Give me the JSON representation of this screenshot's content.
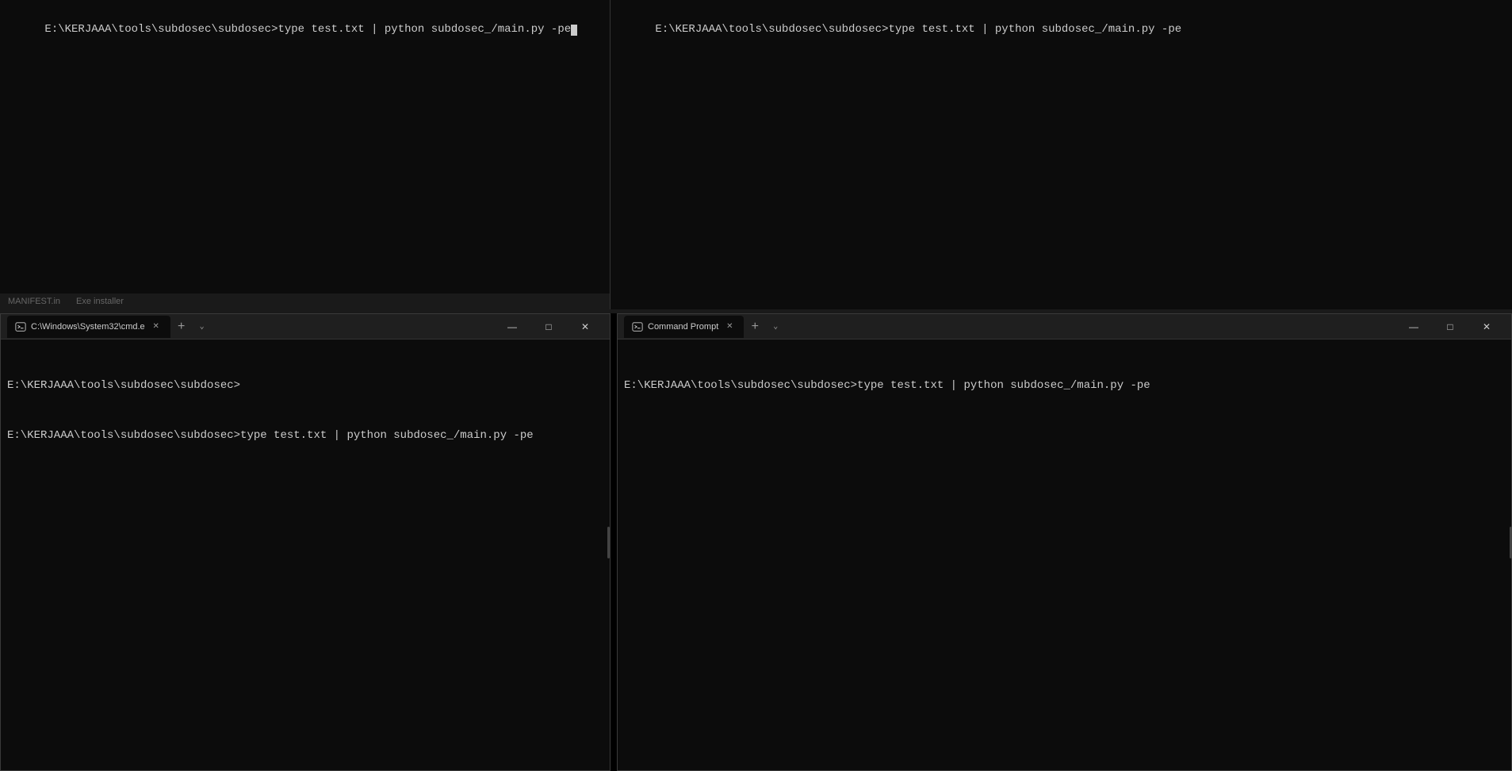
{
  "windows": {
    "top_left": {
      "command_line": "E:\\KERJAAA\\tools\\subdosec\\subdosec>type test.txt | python subdosec_/main.py -pe"
    },
    "top_right": {
      "command_line": "E:\\KERJAAA\\tools\\subdosec\\subdosec>type test.txt | python subdosec_/main.py -pe"
    },
    "bottom_left": {
      "title": "C:\\Windows\\System32\\cmd.e",
      "tab_label": "C:\\Windows\\System32\\cmd.e",
      "line1": "E:\\KERJAAA\\tools\\subdosec\\subdosec>",
      "line2": "E:\\KERJAAA\\tools\\subdosec\\subdosec>type test.txt | python subdosec_/main.py -pe",
      "controls": {
        "minimize": "—",
        "maximize": "□",
        "close": "✕"
      }
    },
    "bottom_right": {
      "title": "Command Prompt",
      "tab_label": "Command Prompt",
      "line1": "E:\\KERJAAA\\tools\\subdosec\\subdosec>type test.txt | python subdosec_/main.py -pe",
      "controls": {
        "minimize": "—",
        "maximize": "□",
        "close": "✕"
      }
    }
  },
  "hints": {
    "item1": "MANIFEST.in",
    "item2": "Exe installer"
  },
  "buttons": {
    "add": "+",
    "chevron_down": "⌄",
    "close_tab": "✕"
  },
  "colors": {
    "terminal_bg": "#0c0c0c",
    "title_bar_bg": "#1f1f1f",
    "text_color": "#cccccc",
    "border_color": "#3a3a3a"
  }
}
